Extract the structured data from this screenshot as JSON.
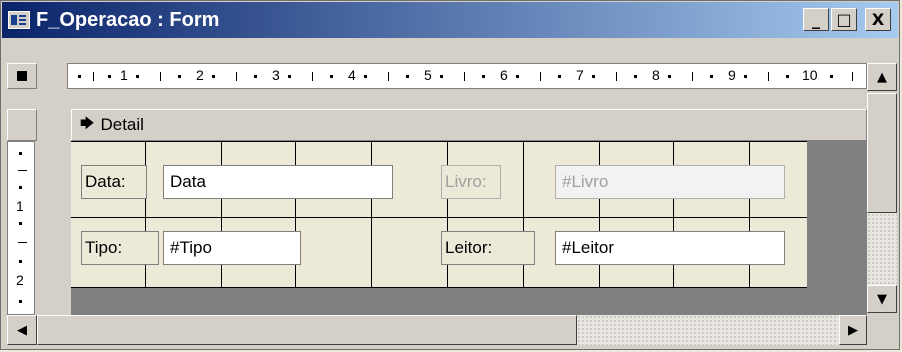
{
  "window": {
    "title": "F_Operacao : Form"
  },
  "title_buttons": {
    "minimize": "_",
    "maximize": "□",
    "close": "X"
  },
  "ruler": {
    "numbers": [
      "1",
      "2",
      "3",
      "4",
      "5",
      "6",
      "7",
      "8",
      "9",
      "10"
    ]
  },
  "vertical_ruler": {
    "numbers": [
      "1",
      "2"
    ]
  },
  "section": {
    "label": "Detail",
    "icon": "section-arrow-icon"
  },
  "fields": {
    "data_label": "Data:",
    "data_value": "Data",
    "livro_label": "Livro:",
    "livro_value": "#Livro",
    "tipo_label": "Tipo:",
    "tipo_value": "#Tipo",
    "leitor_label": "Leitor:",
    "leitor_value": "#Leitor"
  },
  "scrollbars": {
    "up": "▲",
    "down": "▼",
    "left": "◀",
    "right": "▶"
  }
}
